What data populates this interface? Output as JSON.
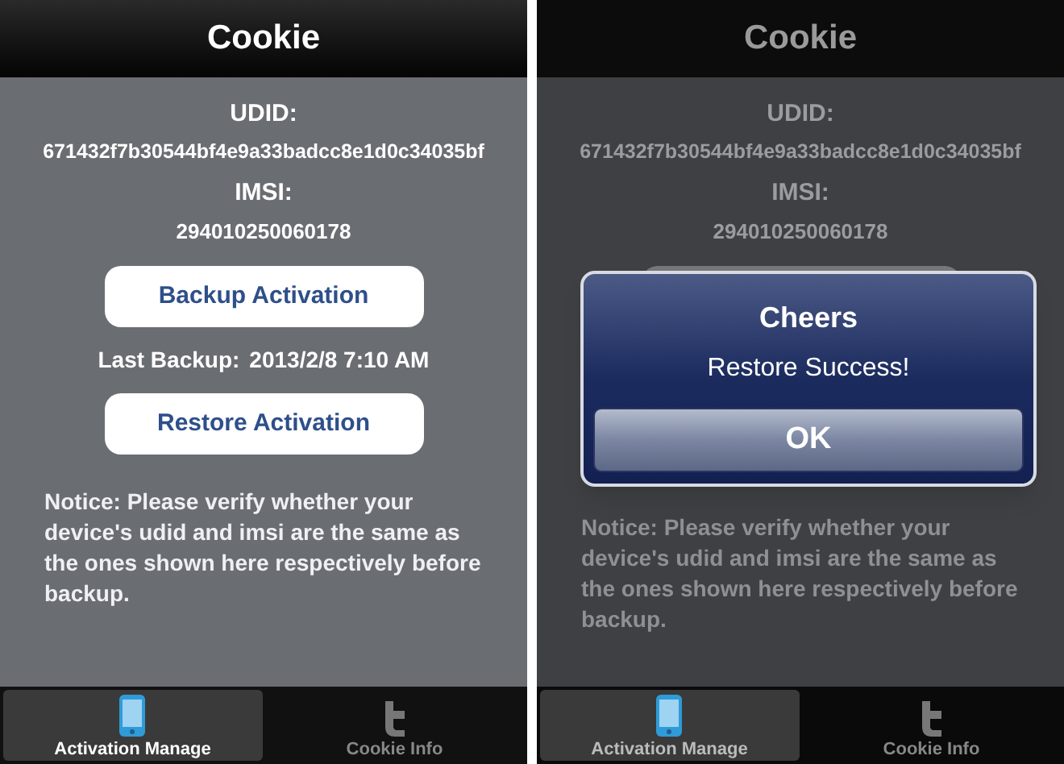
{
  "screens": [
    {
      "title": "Cookie",
      "dimmed": false,
      "udid_label": "UDID:",
      "udid": "671432f7b30544bf4e9a33badcc8e1d0c34035bf",
      "imsi_label": "IMSI:",
      "imsi": "294010250060178",
      "backup_button": "Backup Activation",
      "last_backup_label": "Last Backup:",
      "last_backup": "2013/2/8 7:10 AM",
      "restore_button": "Restore Activation",
      "notice": "Notice: Please verify whether your device's udid and imsi are the same as the ones shown here respectively before backup.",
      "tabs": [
        {
          "label": "Activation Manage",
          "kind": "phone",
          "selected": true
        },
        {
          "label": "Cookie Info",
          "kind": "bird",
          "selected": false
        }
      ]
    },
    {
      "title": "Cookie",
      "dimmed": true,
      "udid_label": "UDID:",
      "udid": "671432f7b30544bf4e9a33badcc8e1d0c34035bf",
      "imsi_label": "IMSI:",
      "imsi": "294010250060178",
      "notice": "Notice: Please verify whether your device's udid and imsi are the same as the ones shown here respectively before backup.",
      "tabs": [
        {
          "label": "Activation Manage",
          "kind": "phone",
          "selected": true
        },
        {
          "label": "Cookie Info",
          "kind": "bird",
          "selected": false
        }
      ],
      "alert": {
        "title": "Cheers",
        "message": "Restore Success!",
        "button": "OK"
      }
    }
  ]
}
